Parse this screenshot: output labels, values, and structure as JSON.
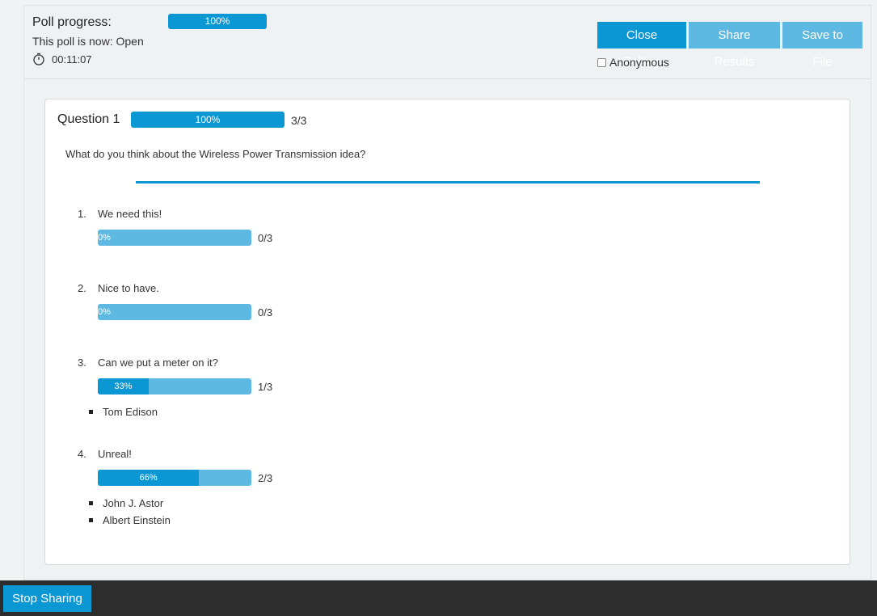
{
  "header": {
    "title": "Poll progress:",
    "progress_label": "100%",
    "status": "This poll is now: Open",
    "timer": "00:11:07",
    "buttons": {
      "close": "Close Polling",
      "share": "Share Results",
      "save": "Save to File"
    },
    "anonymous_label": "Anonymous"
  },
  "question": {
    "title": "Question 1",
    "progress_label": "100%",
    "count": "3/3",
    "text": "What do you think about the Wireless Power Transmission idea?",
    "answers": [
      {
        "num": "1.",
        "label": "We need this!",
        "percent_label": "0%",
        "fraction": 0,
        "count": "0/3",
        "voters": []
      },
      {
        "num": "2.",
        "label": "Nice to have.",
        "percent_label": "0%",
        "fraction": 0,
        "count": "0/3",
        "voters": []
      },
      {
        "num": "3.",
        "label": "Can we put a meter on it?",
        "percent_label": "33%",
        "fraction": 0.33,
        "count": "1/3",
        "voters": [
          "Tom Edison"
        ]
      },
      {
        "num": "4.",
        "label": "Unreal!",
        "percent_label": "66%",
        "fraction": 0.66,
        "count": "2/3",
        "voters": [
          "John J. Astor",
          "Albert Einstein"
        ]
      }
    ]
  },
  "footer": {
    "stop_label": "Stop Sharing"
  },
  "colors": {
    "accent": "#0b96d4",
    "accent_light": "#5db9e2",
    "footer_bg": "#2d2d2d"
  }
}
